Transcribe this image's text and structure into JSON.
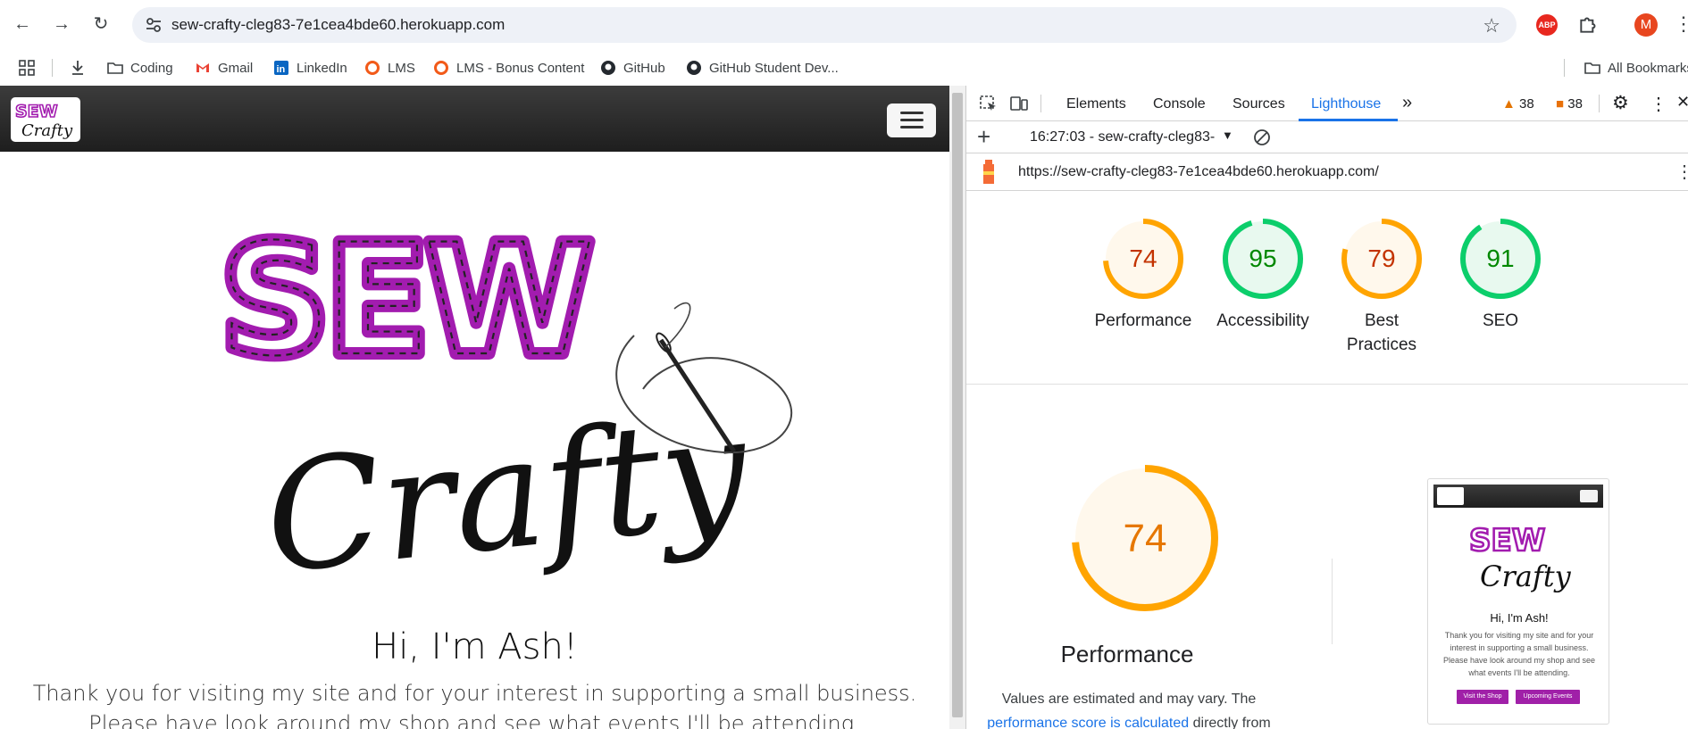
{
  "browser": {
    "url": "sew-crafty-cleg83-7e1cea4bde60.herokuapp.com",
    "extension_abp": "ABP",
    "profile_initial": "M"
  },
  "bookmarks": [
    {
      "label": "Coding",
      "icon": "folder-icon"
    },
    {
      "label": "Gmail",
      "icon": "gmail-icon"
    },
    {
      "label": "LinkedIn",
      "icon": "linkedin-icon"
    },
    {
      "label": "LMS",
      "icon": "lms-icon"
    },
    {
      "label": "LMS - Bonus Content",
      "icon": "lms-icon"
    },
    {
      "label": "GitHub",
      "icon": "github-icon"
    },
    {
      "label": "GitHub Student Dev...",
      "icon": "github-icon"
    }
  ],
  "bookmarks_all": "All Bookmarks",
  "site": {
    "logo_sew": "SEW",
    "logo_crafty": "Crafty",
    "hero_title": "Hi, I'm Ash!",
    "hero_line1": "Thank you for visiting my site and for your interest in supporting a small business.",
    "hero_line2": "Please have look around my shop and see what events I'll be attending."
  },
  "devtools": {
    "tabs": [
      "Elements",
      "Console",
      "Sources",
      "Lighthouse"
    ],
    "active_tab": "Lighthouse",
    "warnings": "38",
    "errors": "38",
    "report_label": "16:27:03 - sew-crafty-cleg83-",
    "report_url": "https://sew-crafty-cleg83-7e1cea4bde60.herokuapp.com/",
    "scores": [
      {
        "label_1": "Performance",
        "label_2": "",
        "value": 74,
        "color": "#ffa400",
        "fill": "#fff8ec",
        "text": "#c33300"
      },
      {
        "label_1": "Accessibility",
        "label_2": "",
        "value": 95,
        "color": "#0cce6b",
        "fill": "#e8f9ef",
        "text": "#008800"
      },
      {
        "label_1": "Best",
        "label_2": "Practices",
        "value": 79,
        "color": "#ffa400",
        "fill": "#fff8ec",
        "text": "#c33300"
      },
      {
        "label_1": "SEO",
        "label_2": "",
        "value": 91,
        "color": "#0cce6b",
        "fill": "#e8f9ef",
        "text": "#008800"
      }
    ],
    "perf_big": {
      "value": 74,
      "title": "Performance"
    },
    "perf_desc_1": "Values are estimated and may vary. The",
    "perf_desc_link": "performance score is calculated",
    "perf_desc_2": "directly from these",
    "thumbnail": {
      "title": "Hi, I'm Ash!",
      "text": "Thank you for visiting my site and for your interest in supporting a small business. Please have look around my shop and see what events I'll be attending.",
      "btn1": "Visit the Shop",
      "btn2": "Upcoming Events"
    }
  }
}
